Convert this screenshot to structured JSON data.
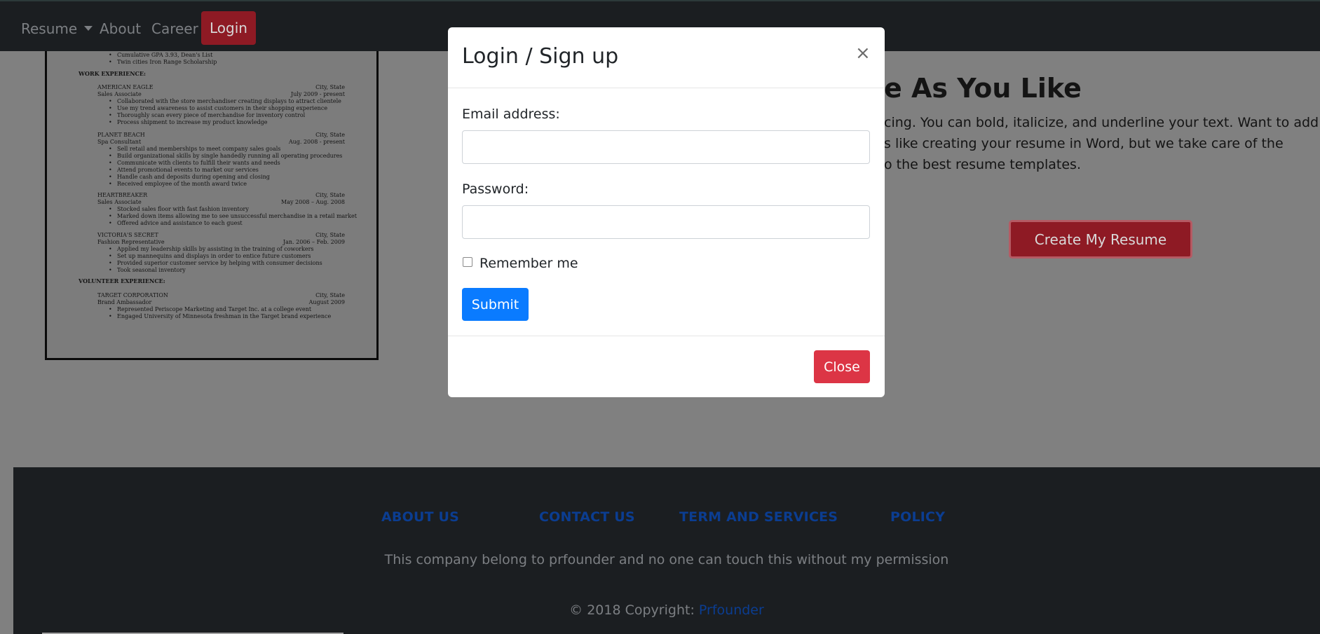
{
  "navbar": {
    "resume_label": "Resume",
    "about_label": "About",
    "career_label": "Career",
    "login_label": "Login"
  },
  "resume_preview": {
    "lines": [
      "Cumulative GPA 3.93, Dean's List",
      "Twin cities Iron Range Scholarship",
      "WORK EXPERIENCE:",
      "AMERICAN EAGLE",
      "City, State",
      "Sales Associate",
      "July 2009 - present",
      "Collaborated with the store merchandiser creating displays to attract clientele",
      "Use my trend awareness to assist customers in their shopping experience",
      "Thoroughly scan every piece of merchandise for inventory control",
      "Process shipment to increase my product knowledge",
      "PLANET BEACH",
      "City, State",
      "Spa Consultant",
      "Aug. 2008 - present",
      "Sell retail and memberships to meet company sales goals",
      "Build organizational skills by single handedly running all operating procedures",
      "Communicate with clients to fulfill their wants and needs",
      "Attend promotional events to market our services",
      "Handle cash and deposits during opening and closing",
      "Received employee of the month award twice",
      "HEARTBREAKER",
      "City, State",
      "Sales Associate",
      "May 2008 – Aug. 2008",
      "Stocked sales floor with fast fashion inventory",
      "Marked down items allowing me to see unsuccessful merchandise in a retail market",
      "Offered advice and assistance to each guest",
      "VICTORIA'S SECRET",
      "City, State",
      "Fashion Representative",
      "Jan. 2006 – Feb. 2009",
      "Applied my leadership skills by assisting in the training of coworkers",
      "Set up mannequins and displays in order to entice future customers",
      "Provided superior customer service by helping with consumer decisions",
      "Took seasonal inventory",
      "VOLUNTEER EXPERIENCE:",
      "TARGET CORPORATION",
      "City, State",
      "Brand Ambassador",
      "August 2009",
      "Represented Periscope Marketing and Target Inc. at a college event",
      "Engaged University of Minnesota freshman in the Target brand experience"
    ]
  },
  "feature": {
    "title": "e As You Like",
    "line1": "cing. You can bold, italicize, and underline your text. Want to add live",
    "line2": "s like creating your resume in Word, but we take care of the",
    "line3": "o the best resume templates.",
    "cta_label": "Create My Resume"
  },
  "modal": {
    "title": "Login / Sign up",
    "close_x": "×",
    "email_label": "Email address:",
    "email_value": "",
    "password_label": "Password:",
    "password_value": "",
    "remember_label": "Remember me",
    "remember_checked": false,
    "submit_label": "Submit",
    "close_label": "Close"
  },
  "footer": {
    "links": [
      "ABOUT US",
      "CONTACT US",
      "TERM AND SERVICES",
      "POLICY"
    ],
    "note": "This company belong to prfounder and no one can touch this without my permission",
    "copyright_prefix": "© 2018 Copyright:",
    "brand": "Prfounder"
  },
  "colors": {
    "navbar_bg": "#1b1e21",
    "overlay_bg": "#808080",
    "login_btn": "#8e1a24",
    "submit_btn": "#0a7bff",
    "close_btn": "#dc3545",
    "footer_link": "#0b3d91"
  }
}
